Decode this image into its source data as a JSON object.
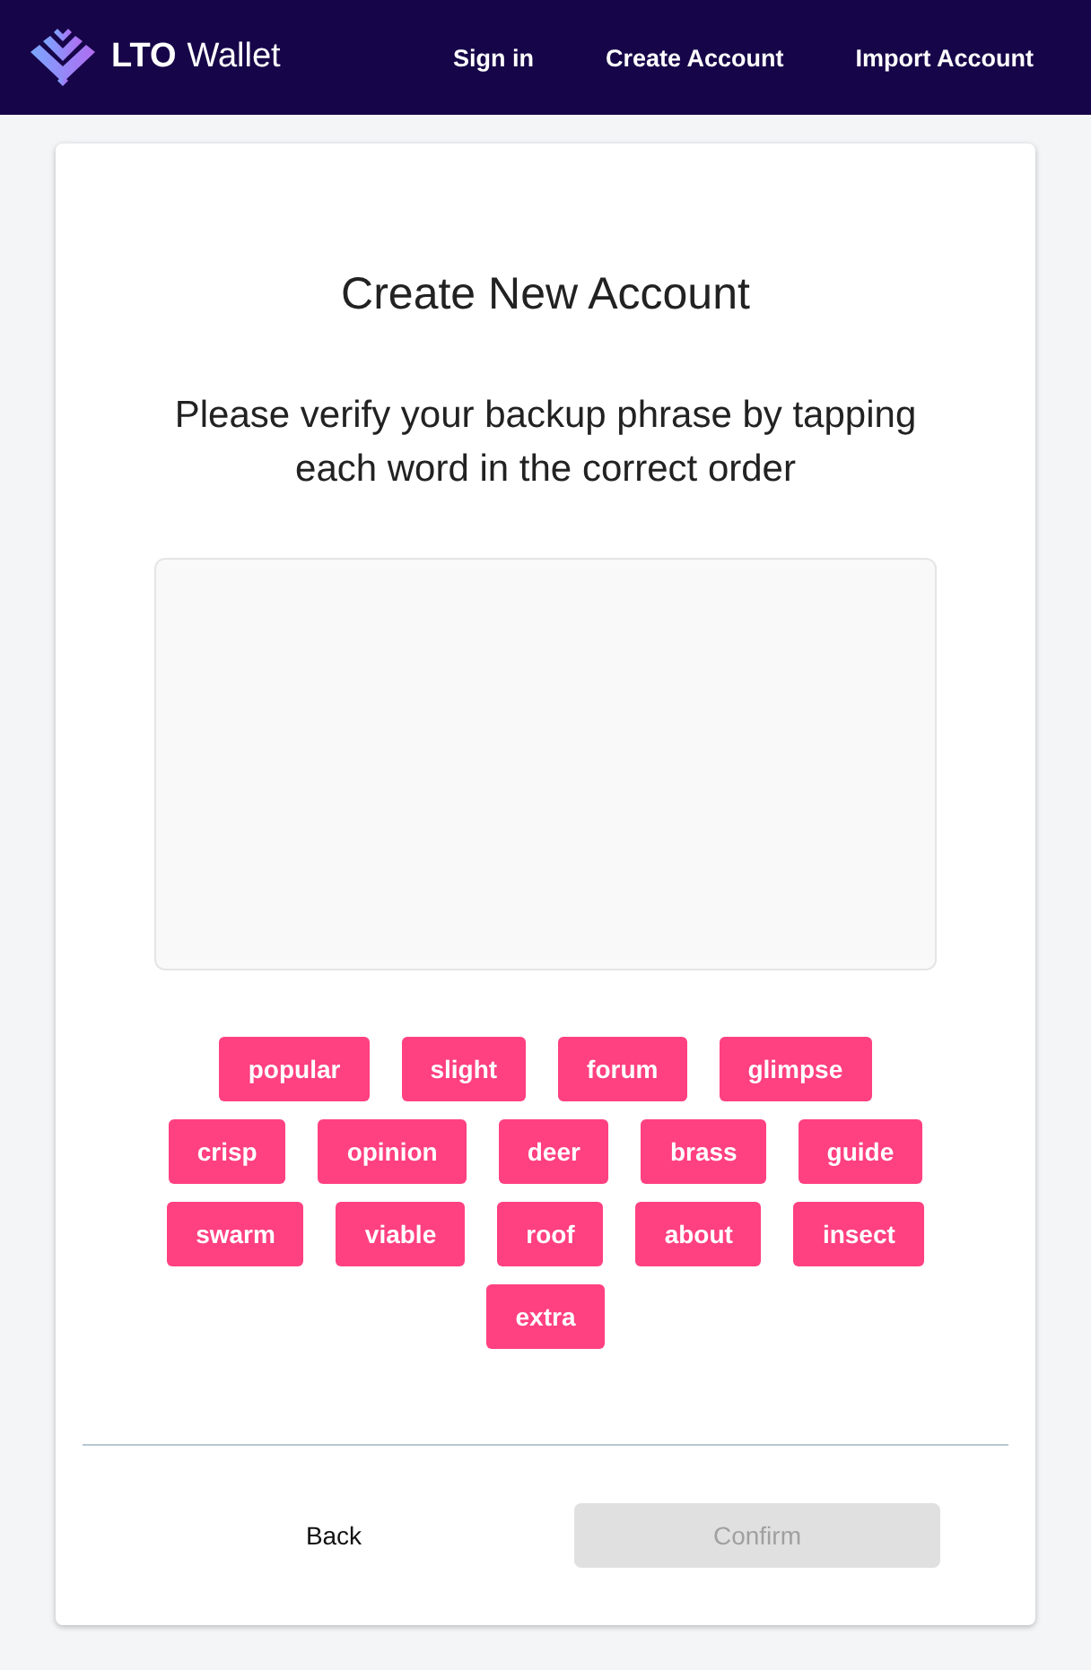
{
  "header": {
    "brand_bold": "LTO",
    "brand": "Wallet",
    "nav": [
      "Sign in",
      "Create Account",
      "Import Account"
    ]
  },
  "card": {
    "title": "Create New Account",
    "instruction": "Please verify your backup phrase by tapping each word in the correct order",
    "words": [
      "popular",
      "slight",
      "forum",
      "glimpse",
      "crisp",
      "opinion",
      "deer",
      "brass",
      "guide",
      "swarm",
      "viable",
      "roof",
      "about",
      "insect",
      "extra"
    ],
    "back": {
      "label": "Back"
    },
    "confirm": {
      "label": "Confirm",
      "disabled": true
    }
  }
}
